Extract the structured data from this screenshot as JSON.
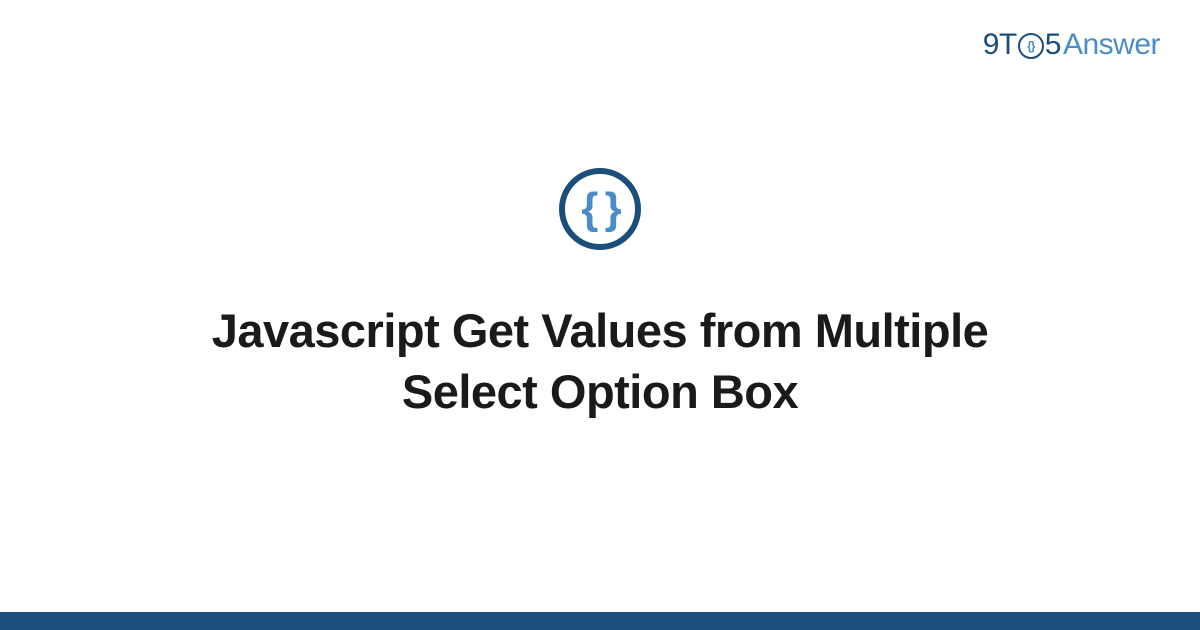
{
  "logo": {
    "part1": "9T",
    "circle_inner": "{}",
    "part2": "5",
    "part3": "Answer"
  },
  "icon": {
    "braces": "{ }"
  },
  "title": "Javascript Get Values from Multiple Select Option Box"
}
